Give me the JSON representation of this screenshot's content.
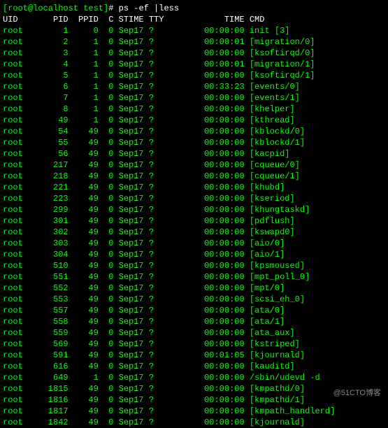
{
  "prompt": {
    "user_host": "[root@localhost test]",
    "symbol": "#",
    "command": "ps -ef |less"
  },
  "header": {
    "uid": "UID",
    "pid": "PID",
    "ppid": "PPID",
    "c": "C",
    "stime": "STIME",
    "tty": "TTY",
    "time": "TIME",
    "cmd": "CMD"
  },
  "rows": [
    {
      "uid": "root",
      "pid": "1",
      "ppid": "0",
      "c": "0",
      "stime": "Sep17",
      "tty": "?",
      "time": "00:00:00",
      "cmd": "init [3]"
    },
    {
      "uid": "root",
      "pid": "2",
      "ppid": "1",
      "c": "0",
      "stime": "Sep17",
      "tty": "?",
      "time": "00:00:01",
      "cmd": "[migration/0]"
    },
    {
      "uid": "root",
      "pid": "3",
      "ppid": "1",
      "c": "0",
      "stime": "Sep17",
      "tty": "?",
      "time": "00:00:00",
      "cmd": "[ksoftirqd/0]"
    },
    {
      "uid": "root",
      "pid": "4",
      "ppid": "1",
      "c": "0",
      "stime": "Sep17",
      "tty": "?",
      "time": "00:00:01",
      "cmd": "[migration/1]"
    },
    {
      "uid": "root",
      "pid": "5",
      "ppid": "1",
      "c": "0",
      "stime": "Sep17",
      "tty": "?",
      "time": "00:00:00",
      "cmd": "[ksoftirqd/1]"
    },
    {
      "uid": "root",
      "pid": "6",
      "ppid": "1",
      "c": "0",
      "stime": "Sep17",
      "tty": "?",
      "time": "00:33:23",
      "cmd": "[events/0]"
    },
    {
      "uid": "root",
      "pid": "7",
      "ppid": "1",
      "c": "0",
      "stime": "Sep17",
      "tty": "?",
      "time": "00:00:00",
      "cmd": "[events/1]"
    },
    {
      "uid": "root",
      "pid": "8",
      "ppid": "1",
      "c": "0",
      "stime": "Sep17",
      "tty": "?",
      "time": "00:00:00",
      "cmd": "[khelper]"
    },
    {
      "uid": "root",
      "pid": "49",
      "ppid": "1",
      "c": "0",
      "stime": "Sep17",
      "tty": "?",
      "time": "00:00:00",
      "cmd": "[kthread]"
    },
    {
      "uid": "root",
      "pid": "54",
      "ppid": "49",
      "c": "0",
      "stime": "Sep17",
      "tty": "?",
      "time": "00:00:00",
      "cmd": "[kblockd/0]"
    },
    {
      "uid": "root",
      "pid": "55",
      "ppid": "49",
      "c": "0",
      "stime": "Sep17",
      "tty": "?",
      "time": "00:00:00",
      "cmd": "[kblockd/1]"
    },
    {
      "uid": "root",
      "pid": "56",
      "ppid": "49",
      "c": "0",
      "stime": "Sep17",
      "tty": "?",
      "time": "00:00:00",
      "cmd": "[kacpid]"
    },
    {
      "uid": "root",
      "pid": "217",
      "ppid": "49",
      "c": "0",
      "stime": "Sep17",
      "tty": "?",
      "time": "00:00:00",
      "cmd": "[cqueue/0]"
    },
    {
      "uid": "root",
      "pid": "218",
      "ppid": "49",
      "c": "0",
      "stime": "Sep17",
      "tty": "?",
      "time": "00:00:00",
      "cmd": "[cqueue/1]"
    },
    {
      "uid": "root",
      "pid": "221",
      "ppid": "49",
      "c": "0",
      "stime": "Sep17",
      "tty": "?",
      "time": "00:00:00",
      "cmd": "[khubd]"
    },
    {
      "uid": "root",
      "pid": "223",
      "ppid": "49",
      "c": "0",
      "stime": "Sep17",
      "tty": "?",
      "time": "00:00:00",
      "cmd": "[kseriod]"
    },
    {
      "uid": "root",
      "pid": "299",
      "ppid": "49",
      "c": "0",
      "stime": "Sep17",
      "tty": "?",
      "time": "00:00:00",
      "cmd": "[khungtaskd]"
    },
    {
      "uid": "root",
      "pid": "301",
      "ppid": "49",
      "c": "0",
      "stime": "Sep17",
      "tty": "?",
      "time": "00:00:00",
      "cmd": "[pdflush]"
    },
    {
      "uid": "root",
      "pid": "302",
      "ppid": "49",
      "c": "0",
      "stime": "Sep17",
      "tty": "?",
      "time": "00:00:00",
      "cmd": "[kswapd0]"
    },
    {
      "uid": "root",
      "pid": "303",
      "ppid": "49",
      "c": "0",
      "stime": "Sep17",
      "tty": "?",
      "time": "00:00:00",
      "cmd": "[aio/0]"
    },
    {
      "uid": "root",
      "pid": "304",
      "ppid": "49",
      "c": "0",
      "stime": "Sep17",
      "tty": "?",
      "time": "00:00:00",
      "cmd": "[aio/1]"
    },
    {
      "uid": "root",
      "pid": "510",
      "ppid": "49",
      "c": "0",
      "stime": "Sep17",
      "tty": "?",
      "time": "00:00:00",
      "cmd": "[kpsmoused]"
    },
    {
      "uid": "root",
      "pid": "551",
      "ppid": "49",
      "c": "0",
      "stime": "Sep17",
      "tty": "?",
      "time": "00:00:00",
      "cmd": "[mpt_poll_0]"
    },
    {
      "uid": "root",
      "pid": "552",
      "ppid": "49",
      "c": "0",
      "stime": "Sep17",
      "tty": "?",
      "time": "00:00:00",
      "cmd": "[mpt/0]"
    },
    {
      "uid": "root",
      "pid": "553",
      "ppid": "49",
      "c": "0",
      "stime": "Sep17",
      "tty": "?",
      "time": "00:00:00",
      "cmd": "[scsi_eh_0]"
    },
    {
      "uid": "root",
      "pid": "557",
      "ppid": "49",
      "c": "0",
      "stime": "Sep17",
      "tty": "?",
      "time": "00:00:00",
      "cmd": "[ata/0]"
    },
    {
      "uid": "root",
      "pid": "558",
      "ppid": "49",
      "c": "0",
      "stime": "Sep17",
      "tty": "?",
      "time": "00:00:00",
      "cmd": "[ata/1]"
    },
    {
      "uid": "root",
      "pid": "559",
      "ppid": "49",
      "c": "0",
      "stime": "Sep17",
      "tty": "?",
      "time": "00:00:00",
      "cmd": "[ata_aux]"
    },
    {
      "uid": "root",
      "pid": "569",
      "ppid": "49",
      "c": "0",
      "stime": "Sep17",
      "tty": "?",
      "time": "00:00:00",
      "cmd": "[kstriped]"
    },
    {
      "uid": "root",
      "pid": "591",
      "ppid": "49",
      "c": "0",
      "stime": "Sep17",
      "tty": "?",
      "time": "00:01:05",
      "cmd": "[kjournald]"
    },
    {
      "uid": "root",
      "pid": "616",
      "ppid": "49",
      "c": "0",
      "stime": "Sep17",
      "tty": "?",
      "time": "00:00:00",
      "cmd": "[kauditd]"
    },
    {
      "uid": "root",
      "pid": "649",
      "ppid": "1",
      "c": "0",
      "stime": "Sep17",
      "tty": "?",
      "time": "00:00:00",
      "cmd": "/sbin/udevd -d"
    },
    {
      "uid": "root",
      "pid": "1815",
      "ppid": "49",
      "c": "0",
      "stime": "Sep17",
      "tty": "?",
      "time": "00:00:00",
      "cmd": "[kmpathd/0]"
    },
    {
      "uid": "root",
      "pid": "1816",
      "ppid": "49",
      "c": "0",
      "stime": "Sep17",
      "tty": "?",
      "time": "00:00:00",
      "cmd": "[kmpathd/1]"
    },
    {
      "uid": "root",
      "pid": "1817",
      "ppid": "49",
      "c": "0",
      "stime": "Sep17",
      "tty": "?",
      "time": "00:00:00",
      "cmd": "[kmpath_handlerd]"
    },
    {
      "uid": "root",
      "pid": "1842",
      "ppid": "49",
      "c": "0",
      "stime": "Sep17",
      "tty": "?",
      "time": "00:00:00",
      "cmd": "[kjournald]"
    }
  ],
  "watermark": "@51CTO博客"
}
